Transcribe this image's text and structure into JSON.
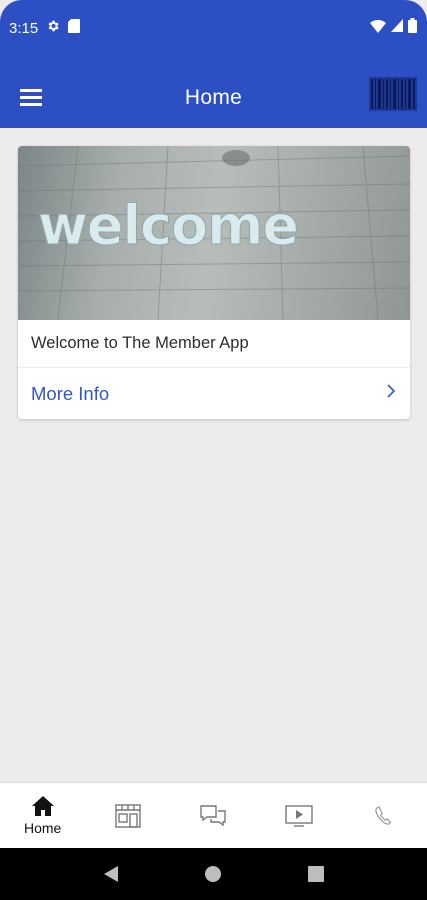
{
  "status_bar": {
    "time": "3:15",
    "left_icons": [
      "gear-icon",
      "sim-card-icon"
    ],
    "right_icons": [
      "wifi-icon",
      "signal-icon",
      "battery-icon"
    ]
  },
  "app_bar": {
    "title": "Home",
    "menu_icon": "hamburger-icon",
    "barcode_icon": "barcode-icon"
  },
  "card": {
    "image_alt_text": "welcome",
    "text": "Welcome to The Member App",
    "link_label": "More Info",
    "link_icon": "chevron-right-icon"
  },
  "bottom_nav": {
    "items": [
      {
        "label": "Home",
        "icon": "home-icon",
        "active": true
      },
      {
        "label": "",
        "icon": "store-icon",
        "active": false
      },
      {
        "label": "",
        "icon": "chat-icon",
        "active": false
      },
      {
        "label": "",
        "icon": "video-icon",
        "active": false
      },
      {
        "label": "",
        "icon": "phone-icon",
        "active": false
      }
    ]
  },
  "system_nav": {
    "buttons": [
      "back-icon",
      "home-circle-icon",
      "recents-icon"
    ]
  },
  "colors": {
    "primary": "#2d4fc4",
    "link": "#3556c6",
    "background": "#edebec"
  }
}
